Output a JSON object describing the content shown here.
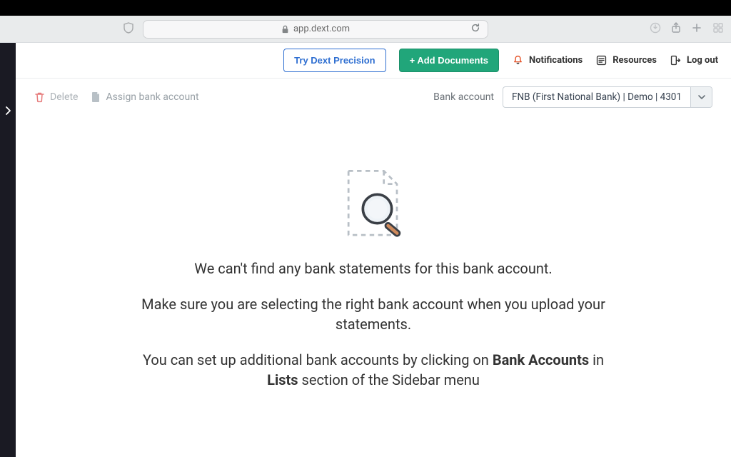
{
  "browser": {
    "url_host": "app.dext.com"
  },
  "app_nav": {
    "try_precision": "Try Dext Precision",
    "add_documents": "+ Add Documents",
    "notifications": "Notifications",
    "resources": "Resources",
    "log_out": "Log out"
  },
  "toolbar": {
    "delete_label": "Delete",
    "assign_label": "Assign bank account",
    "bank_account_label": "Bank account",
    "bank_account_selected": "FNB (First National Bank) | Demo | 4301"
  },
  "empty": {
    "line1": "We can't find any bank statements for this bank account.",
    "line2": "Make sure you are selecting the right bank account when you upload your statements.",
    "line3_pre": "You can set up additional bank accounts by clicking on ",
    "line3_bold1": "Bank Accounts",
    "line3_mid": " in ",
    "line3_bold2": "Lists",
    "line3_post": " section of the Sidebar menu"
  }
}
